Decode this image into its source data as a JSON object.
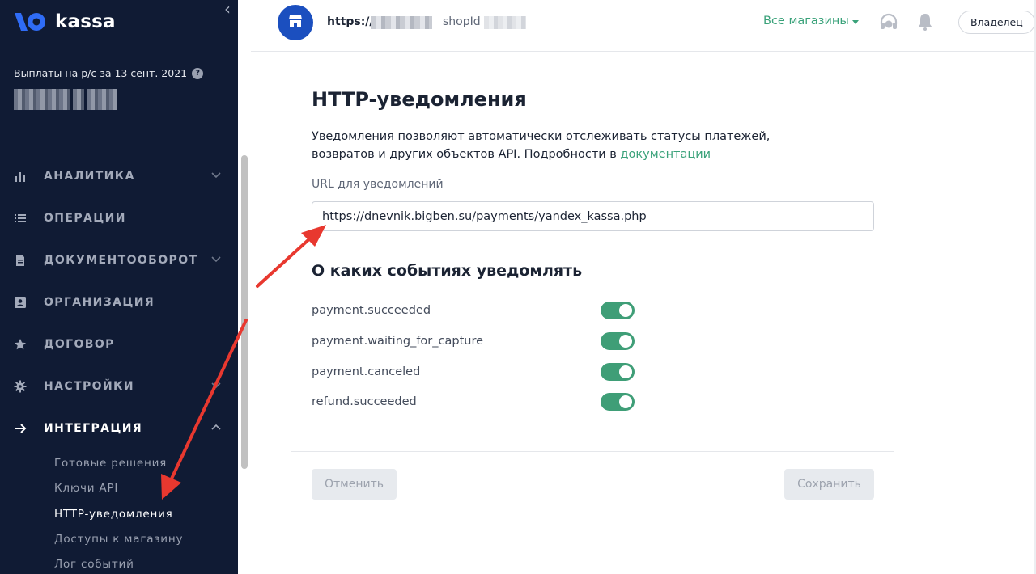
{
  "sidebar": {
    "logo_text": "kassa",
    "payout_label": "Выплаты на р/с за 13 сент. 2021",
    "nav": [
      {
        "label": "АНАЛИТИКА",
        "icon": "bar-chart-icon",
        "chevron": "down"
      },
      {
        "label": "ОПЕРАЦИИ",
        "icon": "list-icon",
        "chevron": "none"
      },
      {
        "label": "ДОКУМЕНТООБОРОТ",
        "icon": "document-icon",
        "chevron": "down"
      },
      {
        "label": "ОРГАНИЗАЦИЯ",
        "icon": "id-card-icon",
        "chevron": "none"
      },
      {
        "label": "ДОГОВОР",
        "icon": "star-icon",
        "chevron": "none"
      },
      {
        "label": "НАСТРОЙКИ",
        "icon": "gear-icon",
        "chevron": "down"
      },
      {
        "label": "ИНТЕГРАЦИЯ",
        "icon": "arrow-right-icon",
        "chevron": "up",
        "active": true
      }
    ],
    "subnav": [
      {
        "label": "Готовые решения"
      },
      {
        "label": "Ключи API"
      },
      {
        "label": "HTTP-уведомления",
        "active": true
      },
      {
        "label": "Доступы к магазину"
      },
      {
        "label": "Лог событий"
      }
    ]
  },
  "header": {
    "shop_url": "https://",
    "shop_id_label": "shopId",
    "stores": "Все магазины",
    "owner": "Владелец"
  },
  "main": {
    "title": "HTTP-уведомления",
    "desc_text": "Уведомления позволяют автоматически отслеживать статусы платежей, возвратов и других объектов API. Подробности в ",
    "desc_link": "документации",
    "url_label": "URL для уведомлений",
    "url_value": "https://dnevnik.bigben.su/payments/yandex_kassa.php",
    "events_title": "О каких событиях уведомлять",
    "events": [
      {
        "label": "payment.succeeded",
        "enabled": true
      },
      {
        "label": "payment.waiting_for_capture",
        "enabled": true
      },
      {
        "label": "payment.canceled",
        "enabled": true
      },
      {
        "label": "refund.succeeded",
        "enabled": true
      }
    ],
    "cancel_label": "Отменить",
    "save_label": "Сохранить"
  },
  "colors": {
    "sidebar_bg": "#101b34",
    "accent_green": "#3aa27a",
    "toggle_on": "#3f9e77",
    "brand_blue": "#1b4fbf",
    "annotation_red": "#e8382f"
  }
}
